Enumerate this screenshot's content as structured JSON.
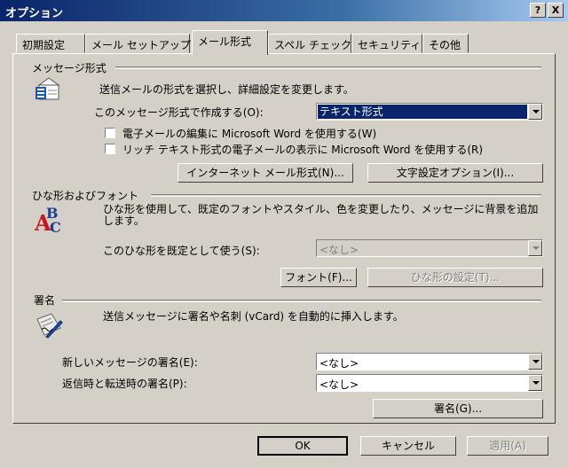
{
  "window": {
    "title": "オプション",
    "help_button": "?",
    "close_button": "X"
  },
  "tabs": [
    {
      "label": "初期設定"
    },
    {
      "label": "メール セットアップ"
    },
    {
      "label": "メール形式"
    },
    {
      "label": "スペル チェック"
    },
    {
      "label": "セキュリティ"
    },
    {
      "label": "その他"
    }
  ],
  "message_format": {
    "group_label": "メッセージ形式",
    "description": "送信メールの形式を選択し、詳細設定を変更します。",
    "compose_label": "このメッセージ形式で作成する(O):",
    "compose_value": "テキスト形式",
    "word_edit_label": "電子メールの編集に Microsoft Word を使用する(W)",
    "word_edit_checked": false,
    "word_rtf_label": "リッチ テキスト形式の電子メールの表示に Microsoft Word を使用する(R)",
    "word_rtf_checked": false,
    "internet_format_button": "インターネット メール形式(N)...",
    "charset_button": "文字設定オプション(I)..."
  },
  "stationery": {
    "group_label": "ひな形およびフォント",
    "description": "ひな形を使用して、既定のフォントやスタイル、色を変更したり、メッセージに背景を追加します。",
    "default_label": "このひな形を既定として使う(S):",
    "default_value": "<なし>",
    "fonts_button": "フォント(F)...",
    "stationery_button": "ひな形の設定(T)..."
  },
  "signature": {
    "group_label": "署名",
    "description": "送信メッセージに署名や名刺 (vCard) を自動的に挿入します。",
    "new_label": "新しいメッセージの署名(E):",
    "new_value": "<なし>",
    "reply_label": "返信時と転送時の署名(P):",
    "reply_value": "<なし>",
    "signatures_button": "署名(G)..."
  },
  "footer": {
    "ok": "OK",
    "cancel": "キャンセル",
    "apply": "適用(A)"
  },
  "colors": {
    "titlebar": "#0a246a",
    "face": "#d4d0c8",
    "selection": "#0a246a"
  }
}
